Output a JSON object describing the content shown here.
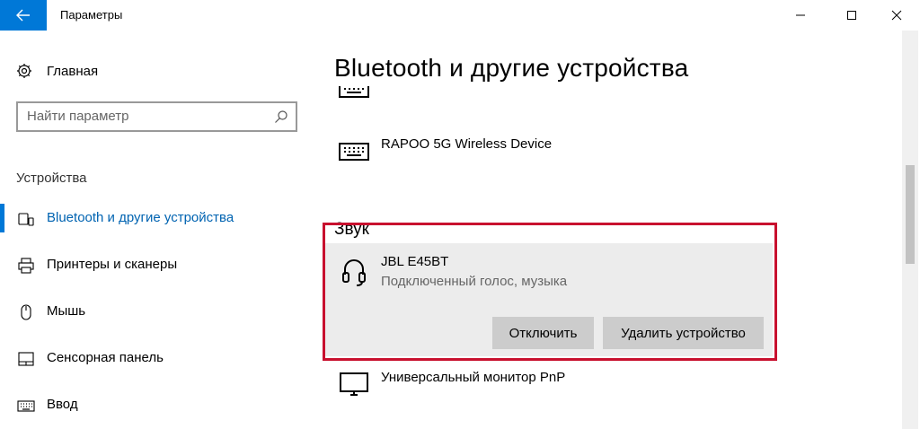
{
  "window": {
    "title": "Параметры"
  },
  "sidebar": {
    "home_label": "Главная",
    "search_placeholder": "Найти параметр",
    "section_title": "Устройства",
    "items": [
      {
        "label": "Bluetooth и другие устройства",
        "icon": "bluetooth-devices-icon",
        "active": true
      },
      {
        "label": "Принтеры и сканеры",
        "icon": "printer-icon",
        "active": false
      },
      {
        "label": "Мышь",
        "icon": "mouse-icon",
        "active": false
      },
      {
        "label": "Сенсорная панель",
        "icon": "touchpad-icon",
        "active": false
      },
      {
        "label": "Ввод",
        "icon": "keyboard-icon",
        "active": false
      }
    ]
  },
  "main": {
    "title": "Bluetooth и другие устройства",
    "devices_above": [
      {
        "name": "",
        "icon": "keyboard-icon"
      },
      {
        "name": "RAPOO 5G Wireless Device",
        "icon": "keyboard-icon"
      }
    ],
    "sound_section": {
      "heading": "Звук",
      "device": {
        "name": "JBL E45BT",
        "status": "Подключенный голос, музыка",
        "icon": "headphones-icon"
      },
      "buttons": {
        "disconnect": "Отключить",
        "remove": "Удалить устройство"
      }
    },
    "devices_below": [
      {
        "name": "Универсальный монитор PnP",
        "icon": "monitor-icon"
      }
    ]
  },
  "colors": {
    "accent": "#0078d7",
    "active_text": "#0063b1",
    "highlight": "#c8102e",
    "selected_bg": "#ececec",
    "button_bg": "#cccccc"
  }
}
